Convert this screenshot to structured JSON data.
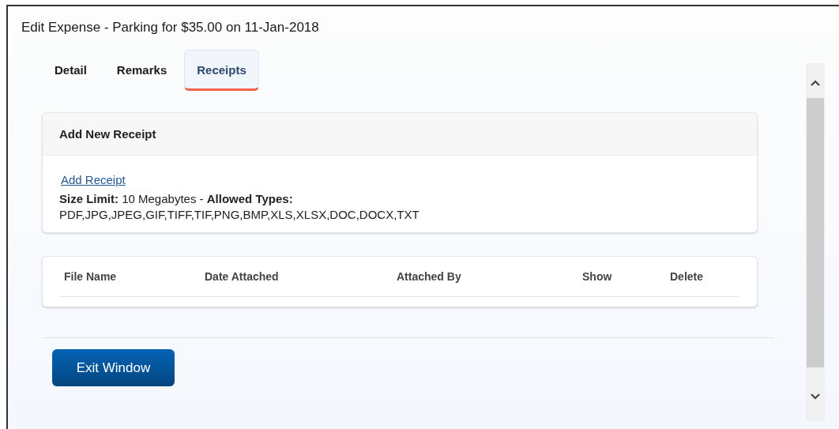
{
  "window": {
    "title": "Edit Expense - Parking for $35.00 on 11-Jan-2018"
  },
  "tabs": [
    {
      "label": "Detail",
      "selected": false
    },
    {
      "label": "Remarks",
      "selected": false
    },
    {
      "label": "Receipts",
      "selected": true
    }
  ],
  "add_receipt_panel": {
    "title": "Add New Receipt",
    "link": "Add Receipt",
    "limits": "**Size Limit:** 10 Megabytes - **Allowed Types:**",
    "allowed_types": "PDF,JPG,JPEG,GIF,TIFF,TIF,PNG,BMP,XLS,XLSX,DOC,DOCX,TXT"
  },
  "receipts_table": {
    "columns": [
      "File Name",
      "Date Attached",
      "Attached By",
      "Show",
      "Delete"
    ]
  },
  "buttons": [
    "Exit Window"
  ]
}
